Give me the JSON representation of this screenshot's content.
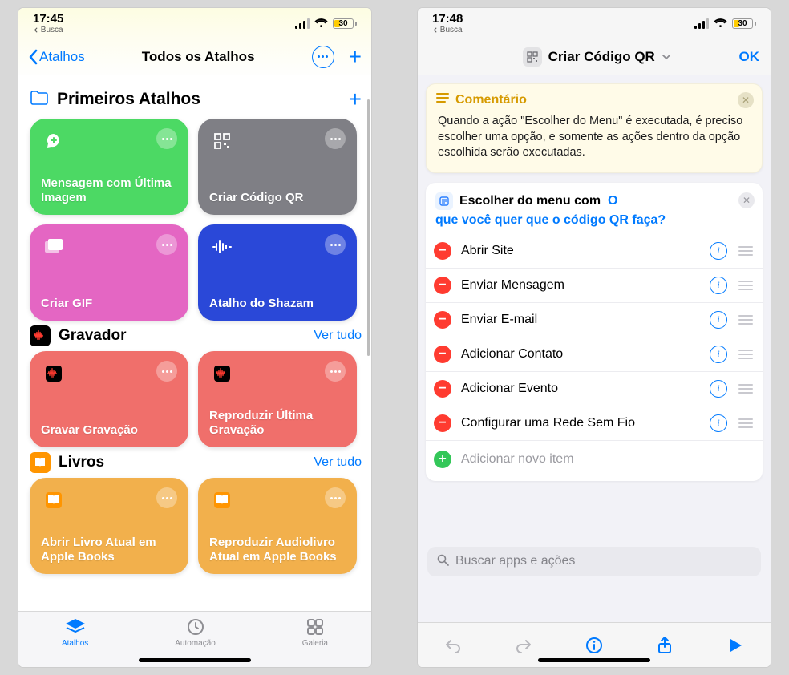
{
  "left": {
    "status": {
      "time": "17:45",
      "breadcrumb": "Busca",
      "battery": {
        "level": 30,
        "color": "#ffcc00"
      }
    },
    "nav": {
      "back": "Atalhos",
      "title": "Todos os Atalhos"
    },
    "sections": {
      "primeiros": {
        "title": "Primeiros Atalhos",
        "tiles": [
          {
            "label": "Mensagem com Última Imagem",
            "bg": "#4cd964",
            "icon": "speech-plus"
          },
          {
            "label": "Criar Código QR",
            "bg": "#7f7f85",
            "icon": "qr"
          },
          {
            "label": "Criar GIF",
            "bg": "#e466c3",
            "icon": "photos"
          },
          {
            "label": "Atalho do Shazam",
            "bg": "#2a48d8",
            "icon": "waveform"
          }
        ]
      },
      "gravador": {
        "title": "Gravador",
        "see_all": "Ver tudo",
        "tiles": [
          {
            "label": "Gravar Gravação",
            "bg": "#f06f6b"
          },
          {
            "label": "Reproduzir Última Gravação",
            "bg": "#f06f6b"
          }
        ]
      },
      "livros": {
        "title": "Livros",
        "see_all": "Ver tudo",
        "tiles": [
          {
            "label": "Abrir Livro Atual em Apple Books",
            "bg": "#f2b04c"
          },
          {
            "label": "Reproduzir Audiolivro Atual em Apple Books",
            "bg": "#f2b04c"
          }
        ]
      }
    },
    "tabs": [
      "Atalhos",
      "Automação",
      "Galeria"
    ]
  },
  "right": {
    "status": {
      "time": "17:48",
      "breadcrumb": "Busca",
      "battery": {
        "level": 30,
        "color": "#ffcc00"
      }
    },
    "nav": {
      "title": "Criar Código QR",
      "ok": "OK"
    },
    "comment": {
      "title": "Comentário",
      "body": "Quando a ação \"Escolher do Menu\" é executada, é preciso escolher uma opção, e somente as ações dentro da opção escolhida serão executadas."
    },
    "menu": {
      "action_label": "Escolher do menu com",
      "variable_short": "O",
      "prompt": "que você quer que o código QR faça?",
      "items": [
        "Abrir Site",
        "Enviar Mensagem",
        "Enviar E-mail",
        "Adicionar Contato",
        "Adicionar Evento",
        "Configurar uma Rede Sem Fio"
      ],
      "add_label": "Adicionar novo item"
    },
    "search_placeholder": "Buscar apps e ações"
  }
}
